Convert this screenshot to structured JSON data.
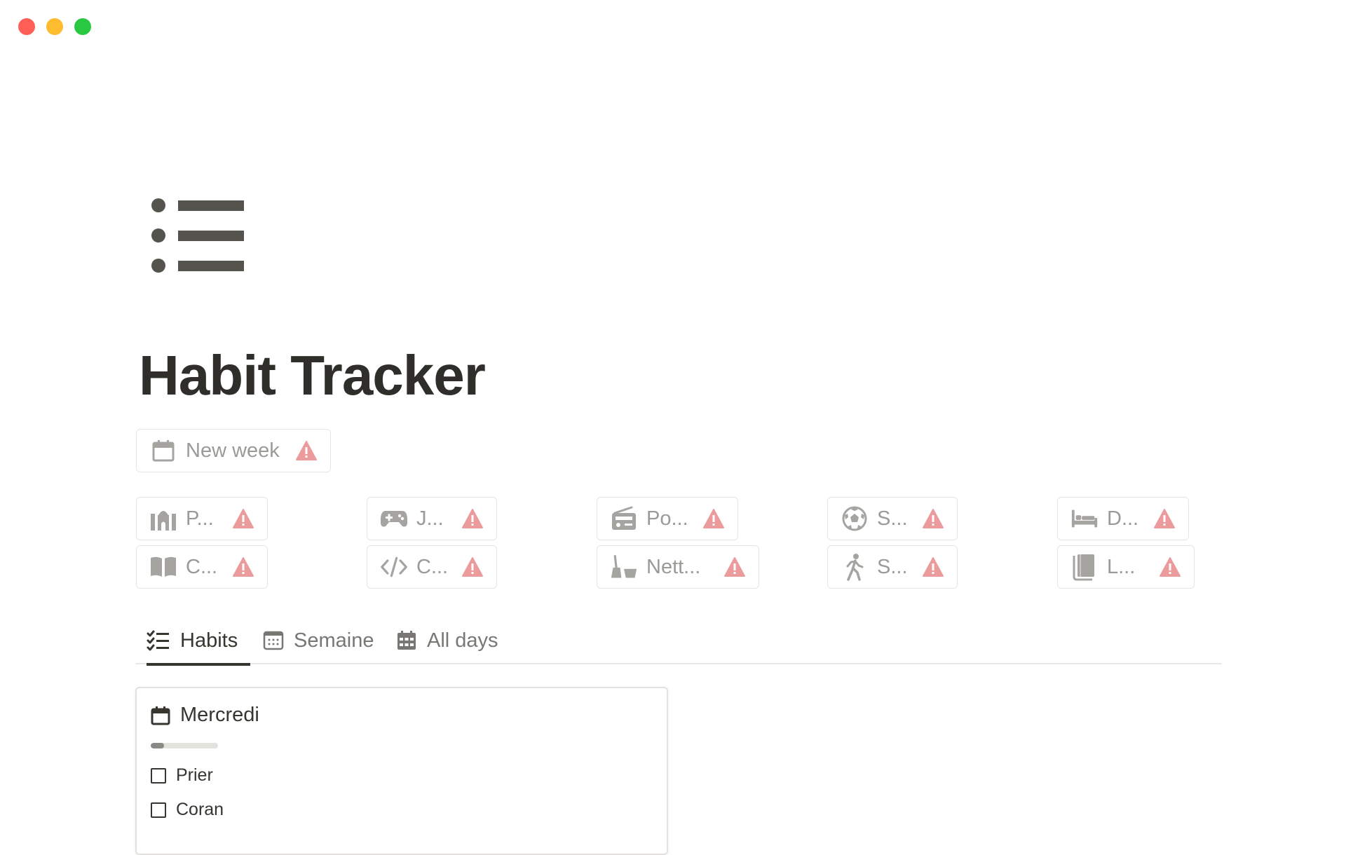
{
  "window": {
    "controls": [
      {
        "name": "close",
        "color": "#ff5f57"
      },
      {
        "name": "minimize",
        "color": "#febc2e"
      },
      {
        "name": "zoom",
        "color": "#28c840"
      }
    ]
  },
  "page": {
    "icon": "bulleted-list-icon",
    "title": "Habit Tracker"
  },
  "new_week": {
    "label": "New week",
    "icon": "calendar-icon"
  },
  "habit_links": [
    {
      "label": "P...",
      "icon": "mosque-icon"
    },
    {
      "label": "C...",
      "icon": "open-book-icon"
    },
    {
      "label": "J...",
      "icon": "gamepad-icon"
    },
    {
      "label": "C...",
      "icon": "code-icon"
    },
    {
      "label": "Po...",
      "icon": "radio-icon"
    },
    {
      "label": "Nett...",
      "icon": "broom-bucket-icon"
    },
    {
      "label": "S...",
      "icon": "soccer-ball-icon"
    },
    {
      "label": "S...",
      "icon": "walking-person-icon"
    },
    {
      "label": "D...",
      "icon": "bed-icon"
    },
    {
      "label": "L...",
      "icon": "books-icon"
    }
  ],
  "tabs": [
    {
      "label": "Habits",
      "icon": "checklist-icon",
      "active": true
    },
    {
      "label": "Semaine",
      "icon": "calendar-grid-icon",
      "active": false
    },
    {
      "label": "All days",
      "icon": "calendar-month-icon",
      "active": false
    }
  ],
  "card": {
    "title": "Mercredi",
    "icon": "calendar-icon",
    "progress": 0.2,
    "items": [
      {
        "label": "Prier",
        "checked": false
      },
      {
        "label": "Coran",
        "checked": false
      }
    ]
  },
  "colors": {
    "text": "#37352f",
    "muted": "#9b9a97",
    "warning": "#eb9b9b",
    "icon_gray": "#a5a4a0",
    "border": "#e6e5e2"
  }
}
